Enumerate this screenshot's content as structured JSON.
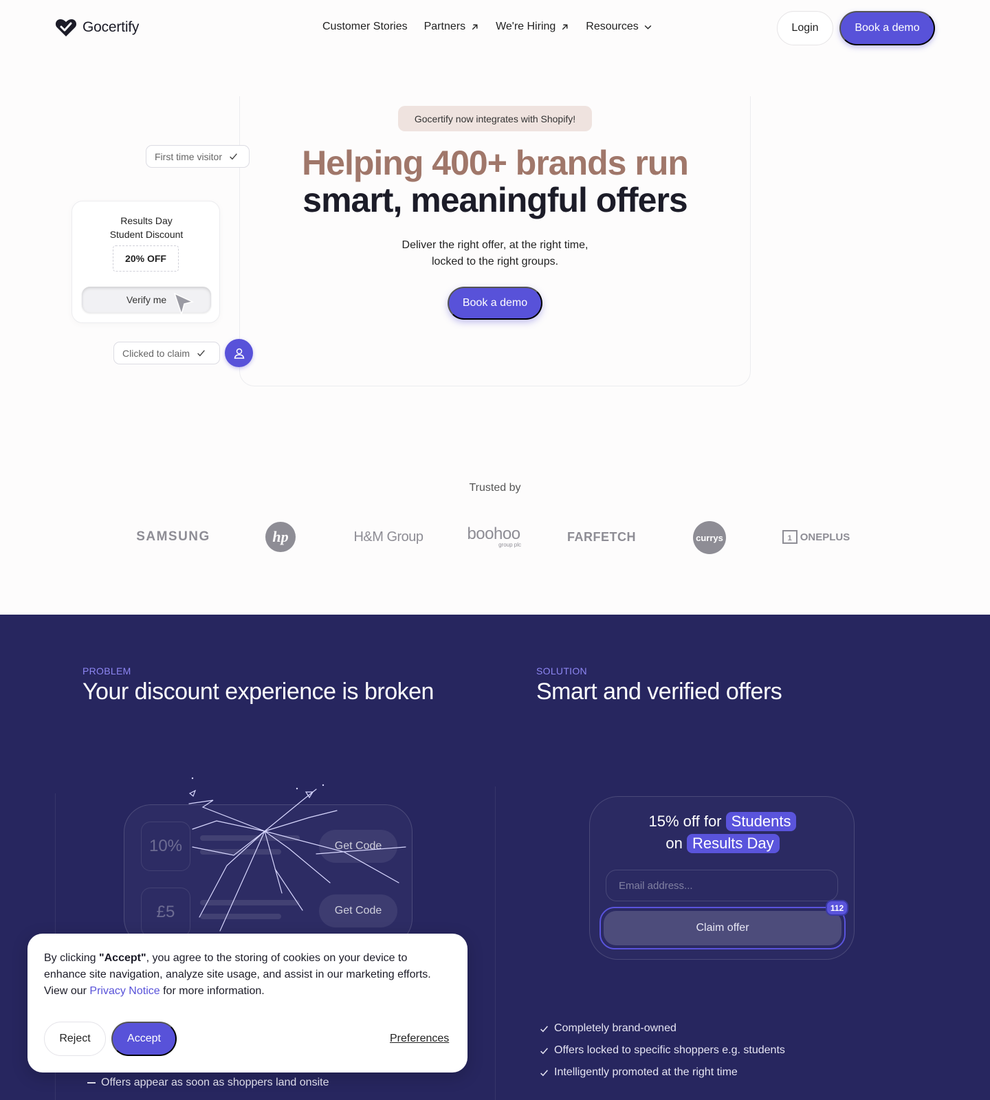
{
  "nav": {
    "brand": "Gocertify",
    "links": [
      {
        "label": "Customer Stories"
      },
      {
        "label": "Partners"
      },
      {
        "label": "We're Hiring"
      },
      {
        "label": "Resources"
      }
    ],
    "login": "Login",
    "cta": "Book a demo"
  },
  "hero": {
    "pill": "Gocertify now integrates with Shopify!",
    "title_line1": "Helping 400+ brands run",
    "title_line2": "smart, meaningful offers",
    "subtitle_line1": "Deliver the right offer, at the right time,",
    "subtitle_line2": "locked to the right groups.",
    "cta": "Book a demo",
    "chip_visitor": "First time visitor",
    "chip_claim": "Clicked to claim",
    "offer_title_line1": "Results Day",
    "offer_title_line2": "Student Discount",
    "offer_code": "20% OFF",
    "verify": "Verify me"
  },
  "trusted": {
    "label": "Trusted by",
    "logos": {
      "samsung": "SAMSUNG",
      "hp": "hp",
      "hm": "H&M Group",
      "boohoo": "boohoo",
      "boohoo_sub": "group plc",
      "farfetch": "FARFETCH",
      "currys": "currys",
      "oneplus_box": "1",
      "oneplus": "ONEPLUS"
    }
  },
  "problem": {
    "eyebrow": "PROBLEM",
    "heading": "Your discount experience is broken",
    "tile1": "10%",
    "tile2": "£5",
    "code1": "Get Code",
    "code2": "Get Code",
    "point": "Offers appear as soon as shoppers land onsite"
  },
  "solution": {
    "eyebrow": "SOLUTION",
    "heading": "Smart and verified offers",
    "line1_prefix": "15% off for",
    "line1_tag": "Students",
    "line2_prefix": "on",
    "line2_tag": "Results Day",
    "email_placeholder": "Email address...",
    "claim": "Claim offer",
    "badge": "112",
    "benefits": [
      "Completely brand-owned",
      "Offers locked to specific shoppers e.g. students",
      "Intelligently promoted at the right time"
    ]
  },
  "cookie": {
    "text_1": "By clicking ",
    "text_accept": "\"Accept\"",
    "text_2": ", you agree to the storing of cookies on your device to enhance site navigation, analyze site usage, and assist in our marketing efforts. View our ",
    "link": "Privacy Notice",
    "text_3": " for more information.",
    "reject": "Reject",
    "accept": "Accept",
    "preferences": "Preferences"
  },
  "colors": {
    "accent": "#5852d9",
    "dark_bg": "#27265f",
    "title_brown": "#a0776a",
    "pill_bg": "#efe3df"
  }
}
